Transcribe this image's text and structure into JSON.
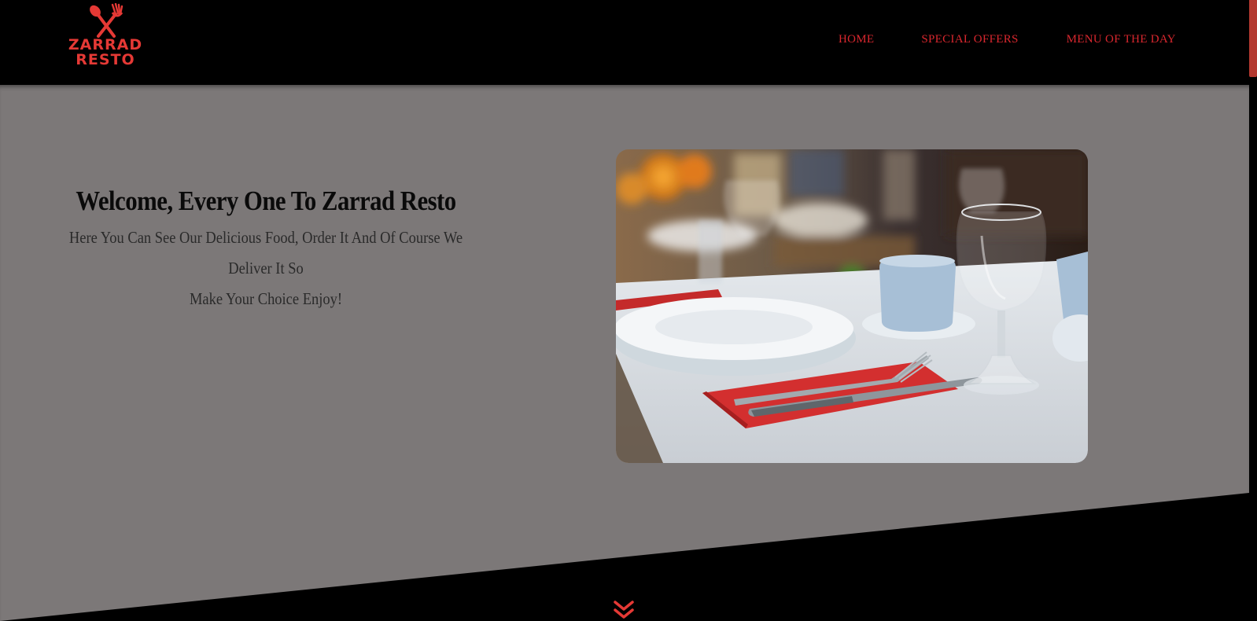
{
  "brand": {
    "name_line1": "ZARRAD",
    "name_line2": "RESTO",
    "logo_icon": "fork-spoon-icon",
    "color": "#e53935"
  },
  "nav": {
    "items": [
      {
        "label": "HOME"
      },
      {
        "label": "SPECIAL OFFERS"
      },
      {
        "label": "MENU OF THE DAY"
      }
    ],
    "color": "#d9272e"
  },
  "hero": {
    "title": "Welcome, Every One To Zarrad Resto",
    "subtitle_line1": "Here You Can See Our Delicious Food, Order It And Of Course We Deliver It So",
    "subtitle_line2": "Make Your Choice Enjoy!",
    "background": "#7c7878",
    "image_icon": "restaurant-table-photo"
  },
  "scroll_down": {
    "icon": "double-chevron-down-icon",
    "color": "#e53935"
  }
}
